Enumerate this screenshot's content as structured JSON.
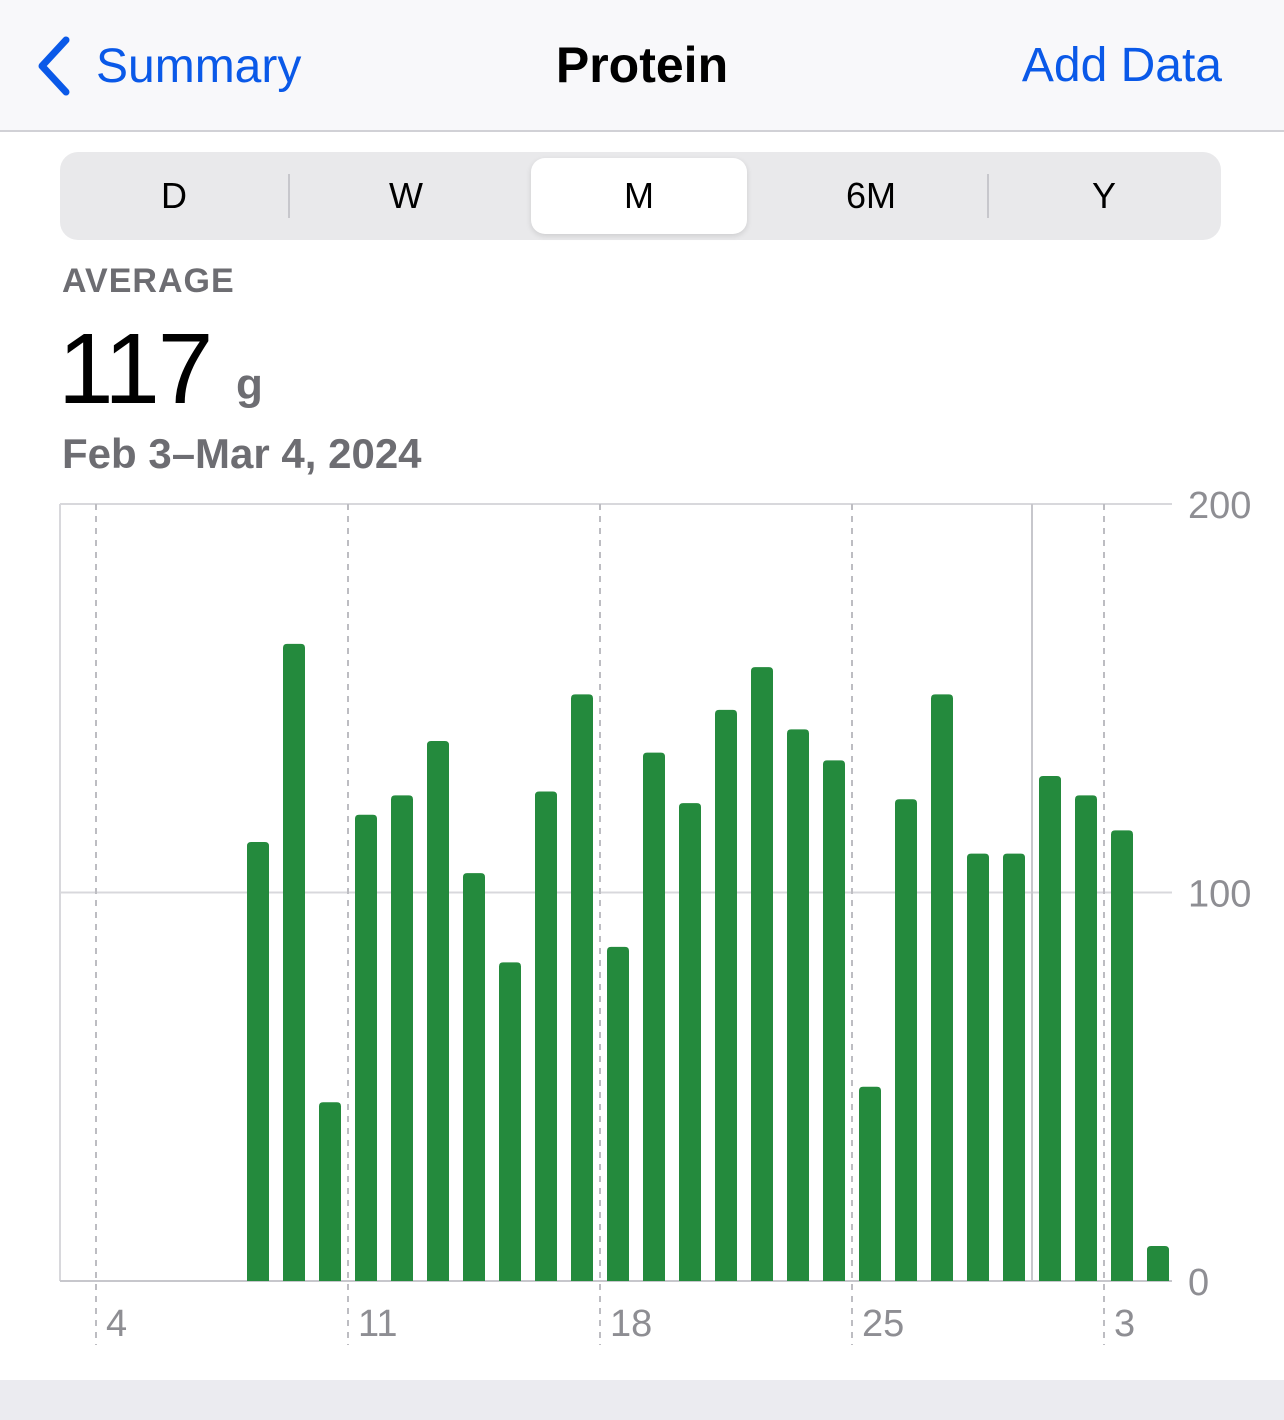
{
  "nav": {
    "back_label": "Summary",
    "title": "Protein",
    "action_label": "Add Data"
  },
  "segments": [
    {
      "label": "D",
      "selected": false
    },
    {
      "label": "W",
      "selected": false
    },
    {
      "label": "M",
      "selected": true
    },
    {
      "label": "6M",
      "selected": false
    },
    {
      "label": "Y",
      "selected": false
    }
  ],
  "summary": {
    "label": "AVERAGE",
    "value": "117",
    "unit": "g",
    "date_range": "Feb 3–Mar 4, 2024"
  },
  "colors": {
    "accent": "#0a59e8",
    "bar": "#248a3d"
  },
  "chart_data": {
    "type": "bar",
    "categories": [
      "Feb 3",
      "Feb 4",
      "Feb 5",
      "Feb 6",
      "Feb 7",
      "Feb 8",
      "Feb 9",
      "Feb 10",
      "Feb 11",
      "Feb 12",
      "Feb 13",
      "Feb 14",
      "Feb 15",
      "Feb 16",
      "Feb 17",
      "Feb 18",
      "Feb 19",
      "Feb 20",
      "Feb 21",
      "Feb 22",
      "Feb 23",
      "Feb 24",
      "Feb 25",
      "Feb 26",
      "Feb 27",
      "Feb 28",
      "Feb 29",
      "Mar 1",
      "Mar 2",
      "Mar 3",
      "Mar 4"
    ],
    "values": [
      0,
      0,
      0,
      0,
      0,
      113,
      164,
      46,
      120,
      125,
      139,
      105,
      82,
      126,
      151,
      86,
      136,
      123,
      147,
      158,
      142,
      134,
      50,
      124,
      151,
      110,
      110,
      130,
      125,
      116,
      9
    ],
    "x_tick_labels": [
      {
        "at": "Feb 4",
        "label": "4"
      },
      {
        "at": "Feb 11",
        "label": "11"
      },
      {
        "at": "Feb 18",
        "label": "18"
      },
      {
        "at": "Feb 25",
        "label": "25"
      },
      {
        "at": "Mar 3",
        "label": "3"
      }
    ],
    "y_ticks": [
      0,
      100,
      200
    ],
    "ylim": [
      0,
      200
    ],
    "grid": true,
    "y_axis_position": "right"
  }
}
